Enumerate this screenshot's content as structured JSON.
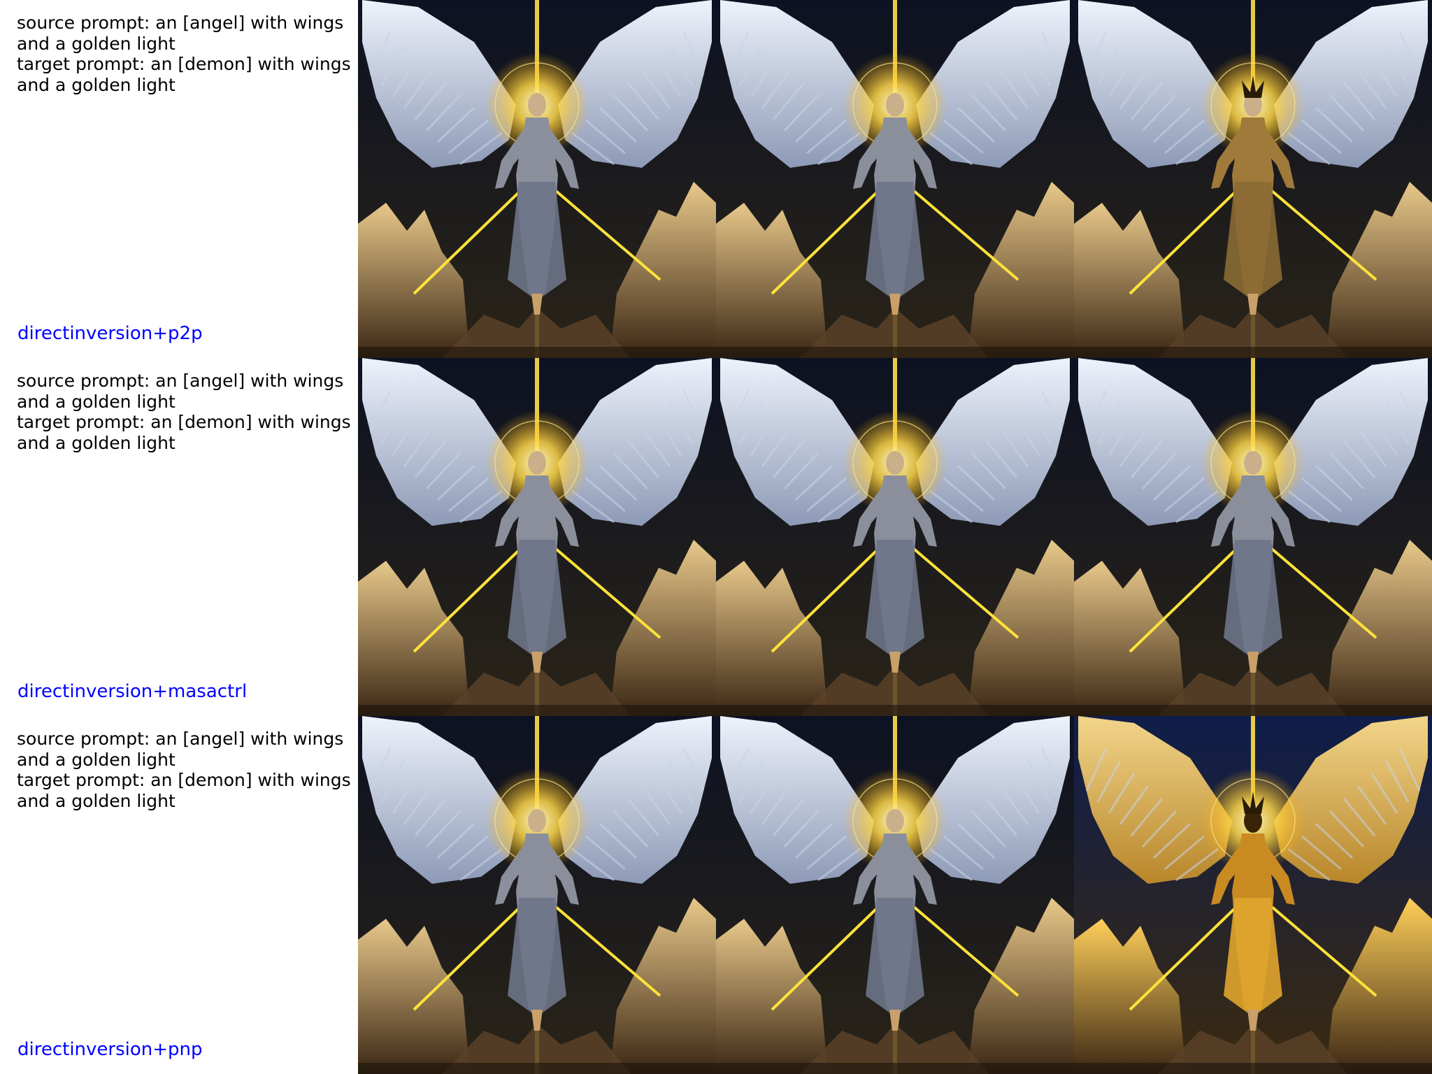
{
  "rows": [
    {
      "source_prompt": "source prompt: an [angel] with wings and a golden light",
      "target_prompt": "target prompt: an [demon] with wings and a golden light",
      "method": "directinversion+p2p",
      "images": [
        {
          "name": "source-image",
          "variant": "angel"
        },
        {
          "name": "reconstruction-image",
          "variant": "angel"
        },
        {
          "name": "edited-image",
          "variant": "demon-robed"
        }
      ]
    },
    {
      "source_prompt": "source prompt: an [angel] with wings and a golden light",
      "target_prompt": "target prompt: an [demon] with wings and a golden light",
      "method": "directinversion+masactrl",
      "images": [
        {
          "name": "source-image",
          "variant": "angel"
        },
        {
          "name": "reconstruction-image",
          "variant": "angel"
        },
        {
          "name": "edited-image",
          "variant": "angel"
        }
      ]
    },
    {
      "source_prompt": "source prompt: an [angel] with wings and a golden light",
      "target_prompt": "target prompt: an [demon] with wings and a golden light",
      "method": "directinversion+pnp",
      "images": [
        {
          "name": "source-image",
          "variant": "angel"
        },
        {
          "name": "reconstruction-image",
          "variant": "angel"
        },
        {
          "name": "edited-image",
          "variant": "demon-golden"
        }
      ]
    }
  ],
  "colors": {
    "text": "#000000",
    "method_label": "#0000ff",
    "background": "#ffffff"
  }
}
